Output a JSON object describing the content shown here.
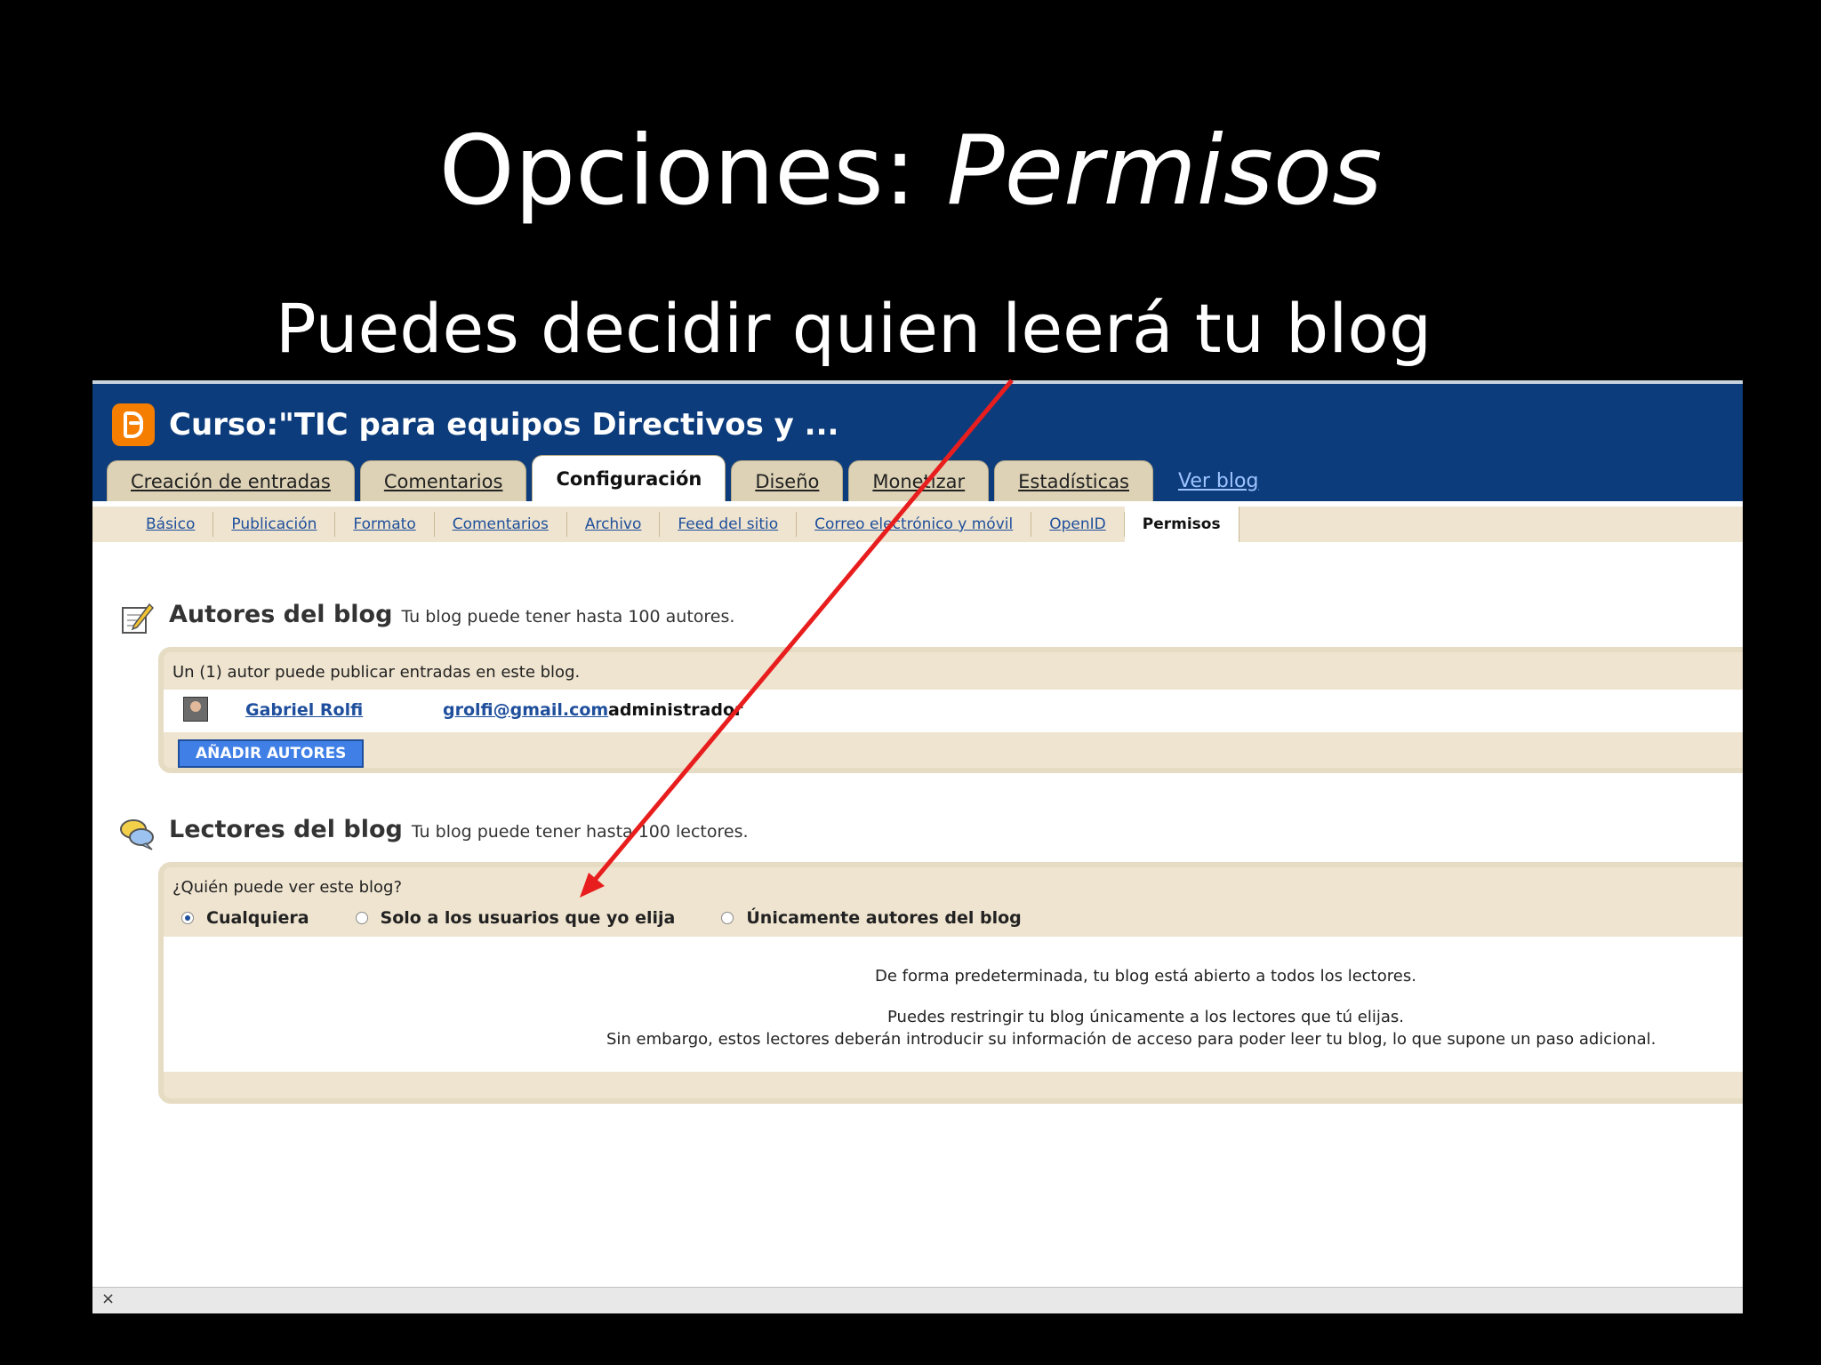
{
  "slide": {
    "title_prefix": "Opciones: ",
    "title_em": "Permisos",
    "subtitle": "Puedes decidir quien leerá tu blog"
  },
  "blog": {
    "name": "Curso:\"TIC para equipos Directivos y ...",
    "tabs": [
      {
        "label": "Creación de entradas",
        "active": false
      },
      {
        "label": "Comentarios",
        "active": false
      },
      {
        "label": "Configuración",
        "active": true
      },
      {
        "label": "Diseño",
        "active": false
      },
      {
        "label": "Monetizar",
        "active": false
      },
      {
        "label": "Estadísticas",
        "active": false
      }
    ],
    "view_blog": "Ver blog",
    "subtabs": [
      {
        "label": "Básico",
        "active": false
      },
      {
        "label": "Publicación",
        "active": false
      },
      {
        "label": "Formato",
        "active": false
      },
      {
        "label": "Comentarios",
        "active": false
      },
      {
        "label": "Archivo",
        "active": false
      },
      {
        "label": "Feed del sitio",
        "active": false
      },
      {
        "label": "Correo electrónico y móvil",
        "active": false
      },
      {
        "label": "OpenID",
        "active": false
      },
      {
        "label": "Permisos",
        "active": true
      }
    ]
  },
  "authors": {
    "title": "Autores del blog",
    "note": "Tu blog puede tener hasta 100 autores.",
    "count_line": "Un (1) autor puede publicar entradas en este blog.",
    "author": {
      "name": "Gabriel Rolfi",
      "email": "grolfi@gmail.com",
      "role": "administrador"
    },
    "add_button": "AÑADIR AUTORES"
  },
  "readers": {
    "title": "Lectores del blog",
    "note": "Tu blog puede tener hasta 100 lectores.",
    "question": "¿Quién puede ver este blog?",
    "options": [
      {
        "label": "Cualquiera",
        "checked": true
      },
      {
        "label": "Solo a los usuarios que yo elija",
        "checked": false
      },
      {
        "label": "Únicamente autores del blog",
        "checked": false
      }
    ],
    "info_1": "De forma predeterminada, tu blog está abierto a todos los lectores.",
    "info_2": "Puedes restringir tu blog únicamente a los lectores que tú elijas.",
    "info_3": "Sin embargo, estos lectores deberán introducir su información de acceso para poder leer tu blog, lo que supone un paso adicional."
  },
  "status_bar": {
    "close_glyph": "×"
  },
  "colors": {
    "arrow": "#e81e1e",
    "header": "#0c3c7c",
    "logo": "#f57d00"
  }
}
